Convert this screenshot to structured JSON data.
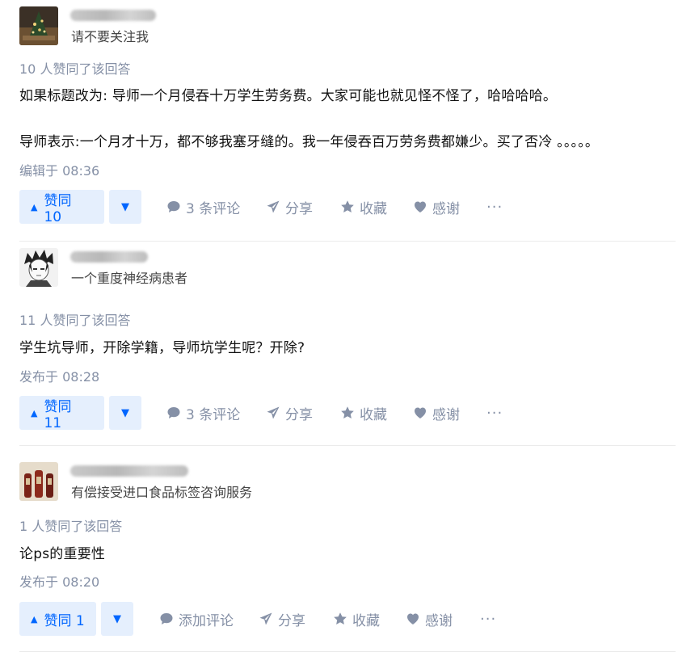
{
  "answers": [
    {
      "bio": "请不要关注我",
      "votes_line": "10 人赞同了该回答",
      "content": [
        "如果标题改为: 导师一个月侵吞十万学生劳务费。大家可能也就见怪不怪了，哈哈哈哈。",
        "导师表示:一个月才十万，都不够我塞牙缝的。我一年侵吞百万劳务费都嫌少。买了否冷 。。。。。"
      ],
      "meta": "编辑于 08:36",
      "vote_label": "赞同 10",
      "comment_label": "3 条评论",
      "share_label": "分享",
      "fav_label": "收藏",
      "thanks_label": "感谢",
      "more_label": "···"
    },
    {
      "bio": "一个重度神经病患者",
      "votes_line": "11 人赞同了该回答",
      "content": [
        "学生坑导师，开除学籍，导师坑学生呢？开除?"
      ],
      "meta": "发布于 08:28",
      "vote_label": "赞同 11",
      "comment_label": "3 条评论",
      "share_label": "分享",
      "fav_label": "收藏",
      "thanks_label": "感谢",
      "more_label": "···"
    },
    {
      "bio": "有偿接受进口食品标签咨询服务",
      "votes_line": "1 人赞同了该回答",
      "content": [
        "论ps的重要性"
      ],
      "meta": "发布于 08:20",
      "vote_label": "赞同 1",
      "comment_label": "添加评论",
      "share_label": "分享",
      "fav_label": "收藏",
      "thanks_label": "感谢",
      "more_label": "···"
    }
  ],
  "icons": {
    "vote_up": "triangle-up-icon",
    "vote_down": "triangle-down-icon",
    "comment": "comment-bubble-icon",
    "share": "paper-plane-icon",
    "favorite": "star-icon",
    "thanks": "heart-icon",
    "more": "more-dots-icon"
  },
  "colors": {
    "accent": "#0066ff",
    "vote_bg": "#e5effd",
    "muted": "#8590a6"
  }
}
